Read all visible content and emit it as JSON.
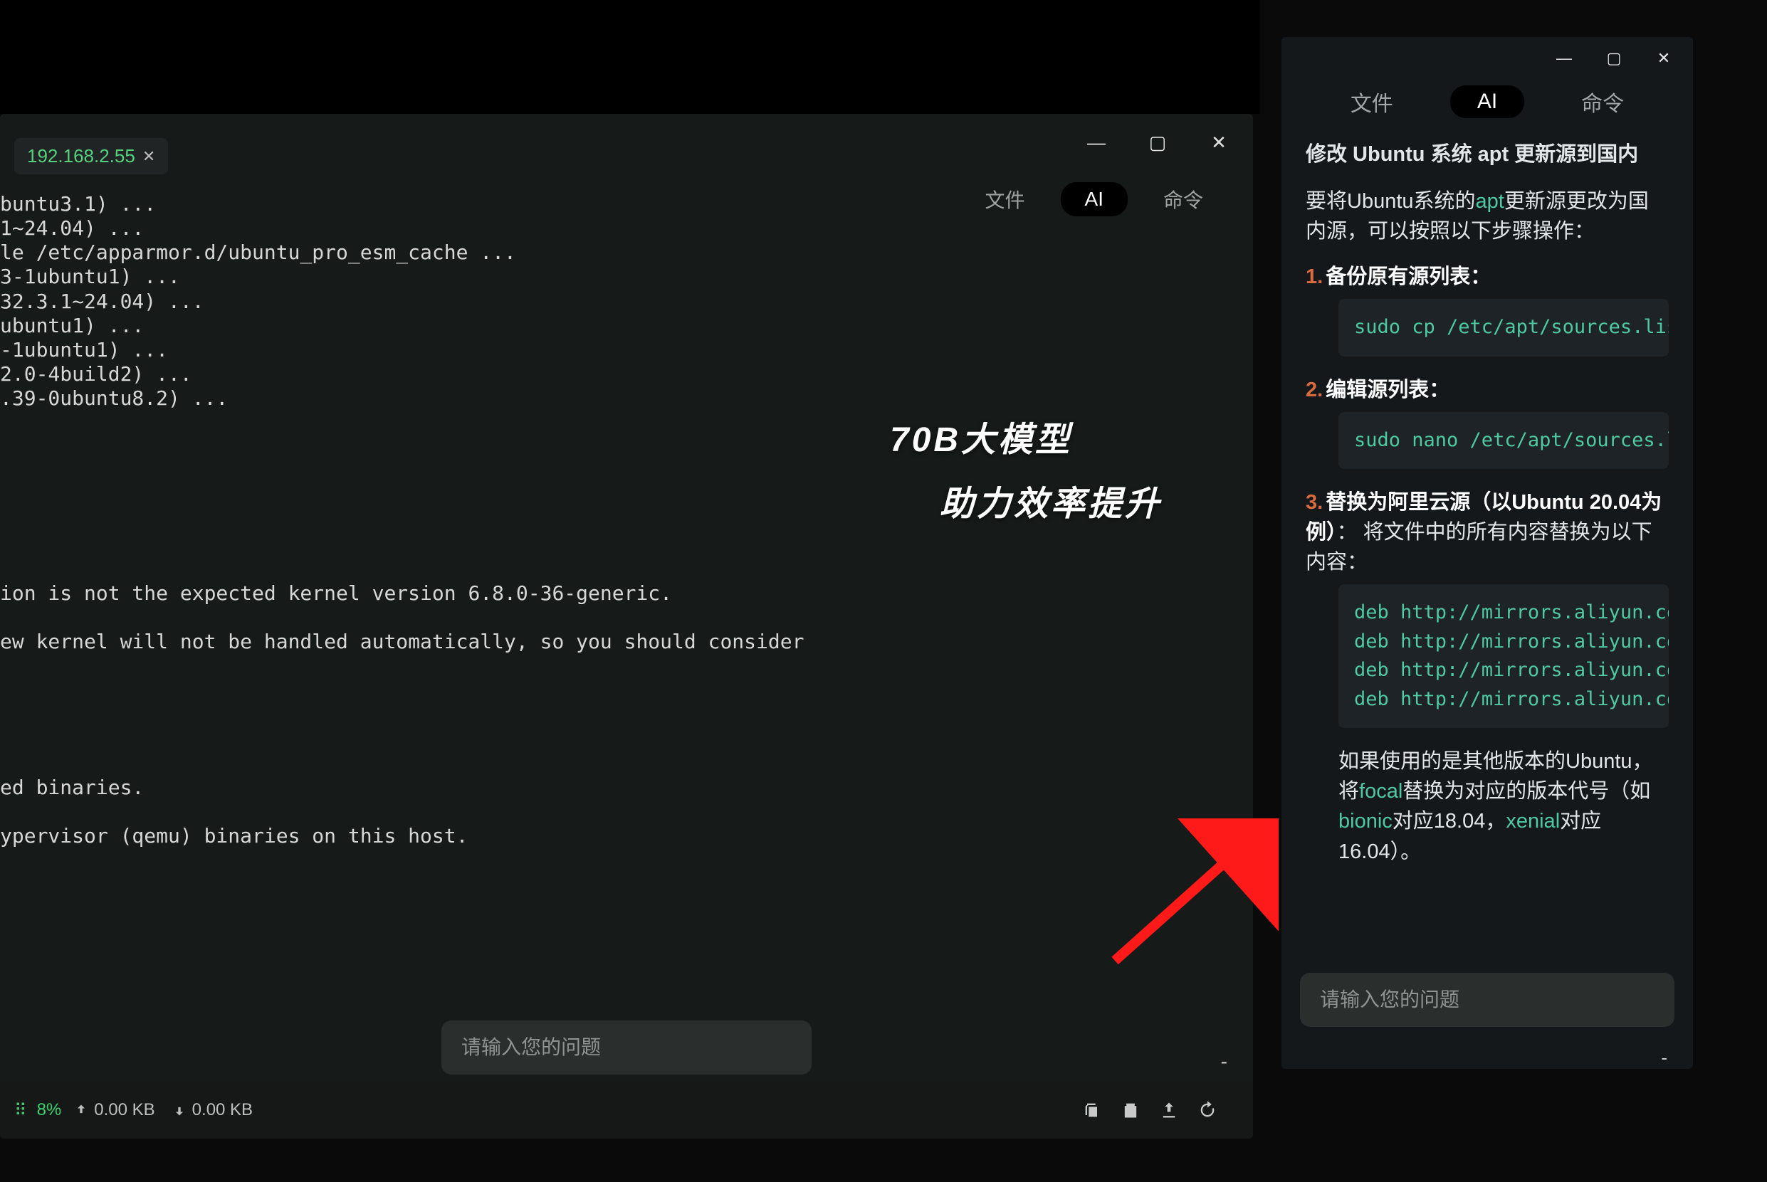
{
  "terminal": {
    "tab_label": "192.168.2.55",
    "tabs": {
      "file": "文件",
      "ai": "AI",
      "cmd": "命令"
    },
    "lines": [
      "buntu3.1) ...",
      "1~24.04) ...",
      "le /etc/apparmor.d/ubuntu_pro_esm_cache ...",
      "3-1ubuntu1) ...",
      "32.3.1~24.04) ...",
      "ubuntu1) ...",
      "-1ubuntu1) ...",
      "2.0-4build2) ...",
      ".39-0ubuntu8.2) ...",
      "",
      "",
      "",
      "",
      "",
      "",
      "",
      "ion is not the expected kernel version 6.8.0-36-generic.",
      "",
      "ew kernel will not be handled automatically, so you should consider",
      "",
      "",
      "",
      "",
      "",
      "ed binaries.",
      "",
      "ypervisor (qemu) binaries on this host."
    ],
    "overlay1": "70B大模型",
    "overlay2": "助力效率提升",
    "input_placeholder": "请输入您的问题",
    "status": {
      "cpu": "8%",
      "up": "0.00 KB",
      "down": "0.00 KB"
    }
  },
  "ai": {
    "tabs": {
      "file": "文件",
      "ai": "AI",
      "cmd": "命令"
    },
    "title": "修改 Ubuntu 系统 apt 更新源到国内",
    "intro_prefix": "要将Ubuntu系统的",
    "intro_hl": "apt",
    "intro_suffix": "更新源更改为国内源，可以按照以下步骤操作：",
    "step1_num": "1.",
    "step1_label": "备份原有源列表：",
    "step1_code": "sudo cp /etc/apt/sources.list /etc/",
    "step2_num": "2.",
    "step2_label": "编辑源列表：",
    "step2_code": "sudo nano /etc/apt/sources.list",
    "step3_num": "3.",
    "step3_label": "替换为阿里云源（以Ubuntu 20.04为例）",
    "step3_after": "： 将文件中的所有内容替换为以下内容：",
    "step3_code_lines": [
      "deb http://mirrors.aliyun.com/ubu",
      "deb http://mirrors.aliyun.com/ubu",
      "deb http://mirrors.aliyun.com/ubu",
      "deb http://mirrors.aliyun.com/ubu"
    ],
    "note_before": "如果使用的是其他版本的Ubuntu，将",
    "note_focal": "focal",
    "note_mid1": "替换为对应的版本代号（如",
    "note_bionic": "bionic",
    "note_mid2": "对应18.04，",
    "note_xenial": "xenial",
    "note_end": "对应16.04）。",
    "input_placeholder": "请输入您的问题"
  }
}
